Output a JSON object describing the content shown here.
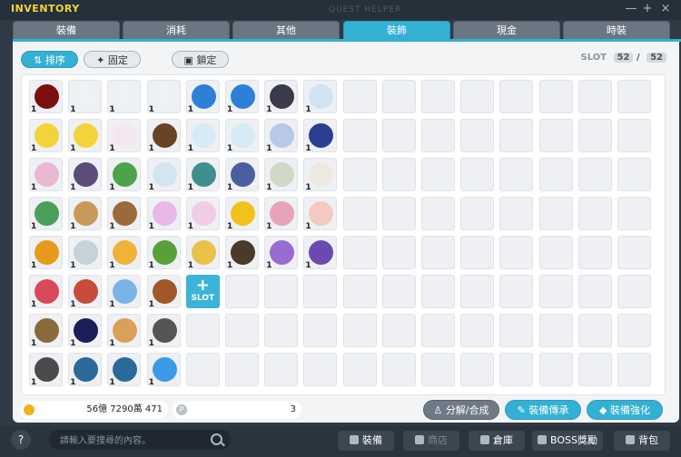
{
  "window": {
    "title": "INVENTORY",
    "ghost_title": "QUEST HELPER",
    "minimize_glyph": "—",
    "maximize_glyph": "+",
    "close_glyph": "×"
  },
  "tabs": [
    {
      "label": "裝備",
      "active": false
    },
    {
      "label": "消耗",
      "active": false
    },
    {
      "label": "其他",
      "active": false
    },
    {
      "label": "裝飾",
      "active": true
    },
    {
      "label": "現金",
      "active": false
    },
    {
      "label": "時裝",
      "active": false
    }
  ],
  "toolbar": {
    "sort_label": "排序",
    "fix_label": "固定",
    "lock_label": "鎖定",
    "slot_label": "SLOT",
    "slot_used": "52",
    "slot_sep": "/",
    "slot_total": "52"
  },
  "items": [
    {
      "color": "#7a1010",
      "count": "1"
    },
    {
      "color": "#eef2f6",
      "count": "1"
    },
    {
      "color": "#eef2f6",
      "count": "1"
    },
    {
      "color": "#eef2f6",
      "count": "1"
    },
    {
      "color": "#2e7fd8",
      "count": "1"
    },
    {
      "color": "#2e7fd8",
      "count": "1"
    },
    {
      "color": "#3a3a4a",
      "count": "1"
    },
    {
      "color": "#cfe3f3",
      "count": "1"
    },
    {
      "color": "#f3d33a",
      "count": "1"
    },
    {
      "color": "#f3d33a",
      "count": "1"
    },
    {
      "color": "#f5e7ee",
      "count": "1"
    },
    {
      "color": "#6a4326",
      "count": "1"
    },
    {
      "color": "#d6ebf5",
      "count": "1"
    },
    {
      "color": "#d6ebf5",
      "count": "1"
    },
    {
      "color": "#b9c7ea",
      "count": "1"
    },
    {
      "color": "#2c3e8f",
      "count": "1"
    },
    {
      "color": "#e8b9d3",
      "count": "1"
    },
    {
      "color": "#5a4d7a",
      "count": "1"
    },
    {
      "color": "#4ea24a",
      "count": "1"
    },
    {
      "color": "#d3e6f0",
      "count": "1"
    },
    {
      "color": "#3f8f8f",
      "count": "1"
    },
    {
      "color": "#4a5fa0",
      "count": "1"
    },
    {
      "color": "#d0d8c8",
      "count": "1"
    },
    {
      "color": "#efe9e4",
      "count": "1"
    },
    {
      "color": "#4aa05a",
      "count": "1"
    },
    {
      "color": "#c89a5a",
      "count": "1"
    },
    {
      "color": "#9a6a3a",
      "count": "1"
    },
    {
      "color": "#e9b8e8",
      "count": "1"
    },
    {
      "color": "#f0cde6",
      "count": "1"
    },
    {
      "color": "#f2c21c",
      "count": "1"
    },
    {
      "color": "#e8a3b9",
      "count": "1"
    },
    {
      "color": "#f3c9c0",
      "count": "1"
    },
    {
      "color": "#e79a1a",
      "count": "1"
    },
    {
      "color": "#c7d2d8",
      "count": "1"
    },
    {
      "color": "#f0b23a",
      "count": "1"
    },
    {
      "color": "#5aa03a",
      "count": "1"
    },
    {
      "color": "#e8c24a",
      "count": "1"
    },
    {
      "color": "#4a3a2a",
      "count": "1"
    },
    {
      "color": "#9a6ad3",
      "count": "1"
    },
    {
      "color": "#6a4ab0",
      "count": "1"
    },
    {
      "color": "#d84a5a",
      "count": "1"
    },
    {
      "color": "#c84a3a",
      "count": "1"
    },
    {
      "color": "#7ab3e6",
      "count": "1"
    },
    {
      "color": "#a0582a",
      "count": "1"
    },
    {
      "color": "#8a6a3a",
      "count": "1"
    },
    {
      "color": "#1a1f5a",
      "count": "1"
    },
    {
      "color": "#d9a05a",
      "count": "1"
    },
    {
      "color": "#555555",
      "count": "1"
    },
    {
      "color": "#4a4a4a",
      "count": "1"
    },
    {
      "color": "#2a6a9a",
      "count": "1"
    },
    {
      "color": "#2a6a9a",
      "count": "1"
    },
    {
      "color": "#3a9ae6",
      "count": "1"
    }
  ],
  "slot_expand": {
    "label": "SLOT",
    "plus": "+"
  },
  "currency": {
    "meso": "56億 7290萬 471",
    "points_badge": "P",
    "points": "3"
  },
  "actions": {
    "disassemble": "分解/合成",
    "transfer": "裝備傳承",
    "enhance": "裝備強化"
  },
  "footer": {
    "help": "?",
    "search_placeholder": "請輸入要搜尋的內容。",
    "equip": "裝備",
    "shop": "商店",
    "storage": "倉庫",
    "boss": "BOSS獎勵",
    "bag": "背包"
  }
}
